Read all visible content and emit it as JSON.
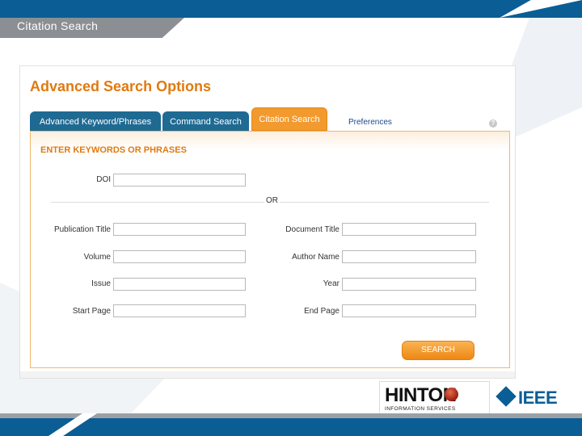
{
  "slide": {
    "title": "Citation Search"
  },
  "page": {
    "title": "Advanced Search Options"
  },
  "tabs": {
    "keyword": "Advanced Keyword/Phrases",
    "command": "Command Search",
    "citation": "Citation Search",
    "preferences": "Preferences",
    "active": "Citation Search"
  },
  "form": {
    "heading": "ENTER KEYWORDS OR PHRASES",
    "doi_label": "DOI",
    "or_text": "OR",
    "publication_title_label": "Publication Title",
    "volume_label": "Volume",
    "issue_label": "Issue",
    "start_page_label": "Start Page",
    "document_title_label": "Document Title",
    "author_name_label": "Author Name",
    "year_label": "Year",
    "end_page_label": "End Page",
    "values": {
      "doi": "",
      "publication_title": "",
      "volume": "",
      "issue": "",
      "start_page": "",
      "document_title": "",
      "author_name": "",
      "year": "",
      "end_page": ""
    },
    "search_button": "SEARCH"
  },
  "logos": {
    "hinton_name": "HINTON",
    "hinton_tagline": "INFORMATION SERVICES",
    "ieee": "IEEE"
  },
  "colors": {
    "brand_blue": "#0a5e95",
    "accent_orange": "#e07a10",
    "tab_blue": "#1e6a93",
    "active_tab_orange": "#f29a2e"
  },
  "icons": {
    "help": "question-circle-icon",
    "ieee_mark": "ieee-diamond-icon"
  }
}
